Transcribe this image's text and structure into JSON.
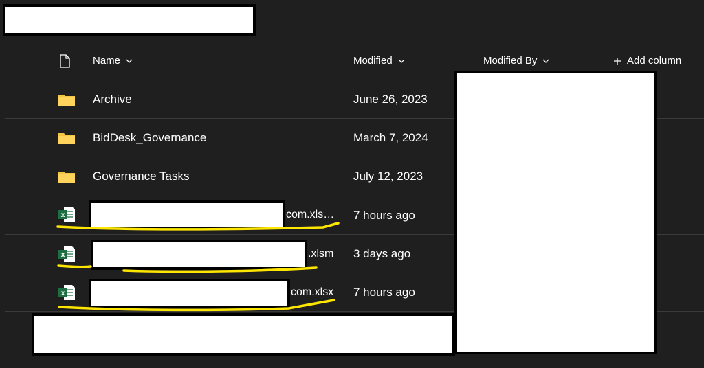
{
  "header": {
    "file_type_icon": "document-icon",
    "name_label": "Name",
    "modified_label": "Modified",
    "modified_by_label": "Modified By",
    "add_column_label": "Add column"
  },
  "rows": [
    {
      "type": "folder",
      "icon": "folder-icon",
      "name": "Archive",
      "modified": "June 26, 2023"
    },
    {
      "type": "folder",
      "icon": "folder-icon",
      "name": "BidDesk_Governance",
      "modified": "March 7, 2024"
    },
    {
      "type": "folder",
      "icon": "folder-icon",
      "name": "Governance Tasks",
      "modified": "July 12, 2023"
    },
    {
      "type": "excel",
      "icon": "excel-file-icon",
      "name_suffix": "com.xls…",
      "modified": "7 hours ago"
    },
    {
      "type": "excel",
      "icon": "excel-file-icon",
      "name_suffix": ".xlsm",
      "modified": "3 days ago"
    },
    {
      "type": "excel",
      "icon": "excel-file-icon",
      "name_suffix": "com.xlsx",
      "modified": "7 hours ago"
    }
  ],
  "colors": {
    "background": "#1f1f1f",
    "divider": "#3a3a3a",
    "folder": "#f5c542",
    "excel": "#1d6f42",
    "highlight": "#ffe600",
    "redaction": "#ffffff"
  }
}
